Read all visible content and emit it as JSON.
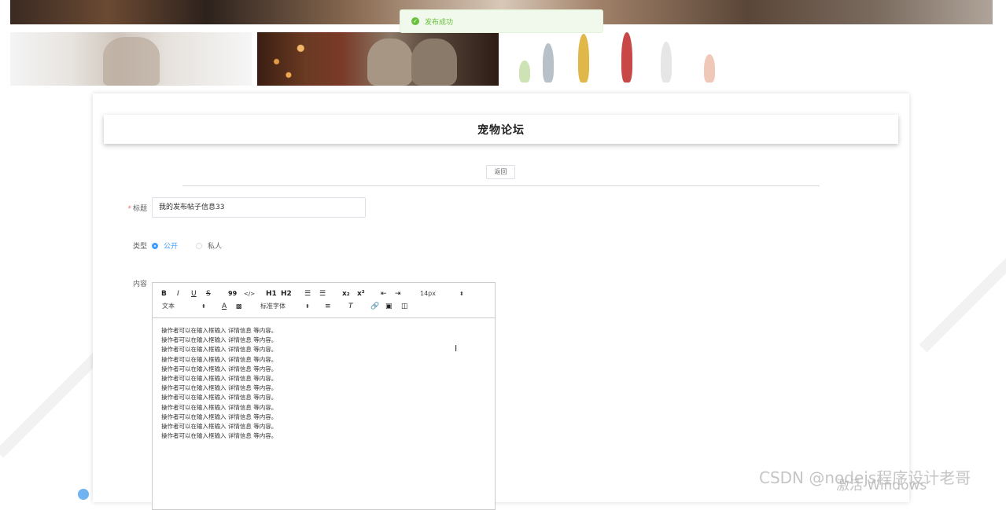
{
  "toast": {
    "icon": "check-circle-icon",
    "message": "发布成功",
    "color": "#67c23a"
  },
  "page": {
    "title": "宠物论坛"
  },
  "actions": {
    "back_label": "返回"
  },
  "form": {
    "title_label": "标题",
    "title_value": "我的发布帖子信息33",
    "type_label": "类型",
    "type_options": [
      "公开",
      "私人"
    ],
    "type_selected": "公开",
    "content_label": "内容"
  },
  "editor": {
    "toolbar_row1": [
      "B",
      "I",
      "U",
      "S",
      "99",
      "</>",
      "H1",
      "H2",
      "ordered-list",
      "bullet-list",
      "x₂",
      "x²",
      "outdent",
      "indent"
    ],
    "size_value": "14px",
    "header_value": "文本",
    "font_value": "标准字体",
    "content_lines": [
      "操作者可以在输入框输入  详情信息  等内容。",
      "操作者可以在输入框输入  详情信息  等内容。",
      "操作者可以在输入框输入  详情信息  等内容。",
      "操作者可以在输入框输入  详情信息  等内容。",
      "操作者可以在输入框输入  详情信息  等内容。",
      "操作者可以在输入框输入  详情信息  等内容。",
      "操作者可以在输入框输入  详情信息  等内容。",
      "操作者可以在输入框输入  详情信息  等内容。",
      "操作者可以在输入框输入  详情信息  等内容。",
      "操作者可以在输入框输入  详情信息  等内容。",
      "操作者可以在输入框输入  详情信息  等内容。",
      "操作者可以在输入框输入  详情信息  等内容。"
    ]
  },
  "watermarks": {
    "csdn": "CSDN @nodejs程序设计老哥",
    "windows": "激活 Windows"
  },
  "colors": {
    "primary": "#409eff",
    "required": "#f56c6c",
    "success": "#67c23a"
  }
}
